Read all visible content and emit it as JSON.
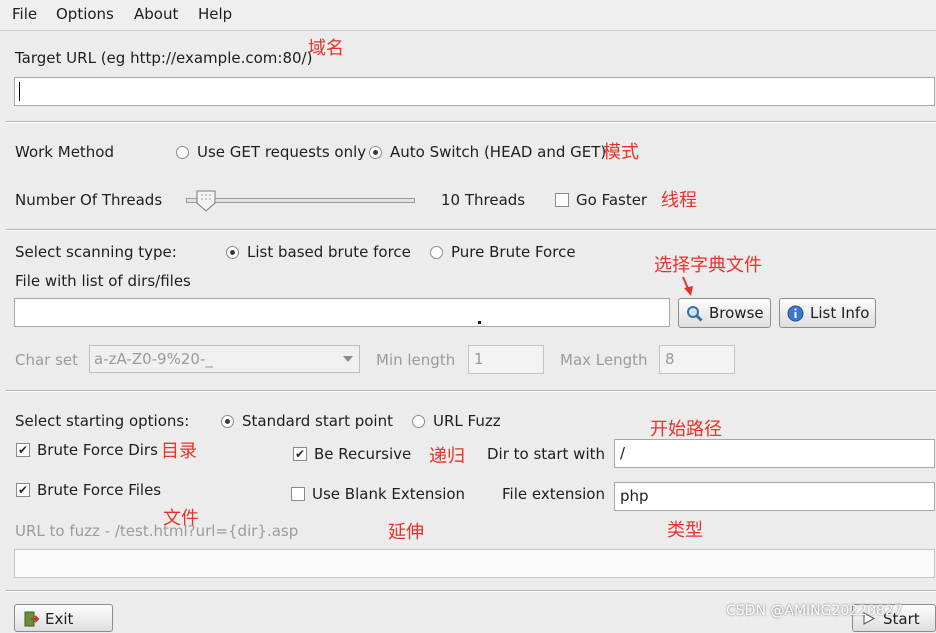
{
  "menu": [
    "File",
    "Options",
    "About",
    "Help"
  ],
  "target": {
    "label": "Target URL (eg http://example.com:80/)",
    "value": ""
  },
  "work_method": {
    "label": "Work Method",
    "options": [
      "Use GET requests only",
      "Auto Switch (HEAD and GET)"
    ],
    "selected": "Auto Switch (HEAD and GET)"
  },
  "threads": {
    "label": "Number Of Threads",
    "value_text": "10 Threads",
    "go_faster": "Go Faster",
    "level_fraction": 0.1
  },
  "scan_type": {
    "label": "Select scanning type:",
    "options": [
      "List based brute force",
      "Pure Brute Force"
    ],
    "selected": "List based brute force"
  },
  "file_list": {
    "label": "File with list of dirs/files",
    "value": "",
    "browse_label": "Browse",
    "list_info_label": "List Info"
  },
  "charset": {
    "label": "Char set",
    "value": "a-zA-Z0-9%20-_",
    "min_label": "Min length",
    "min_value": "1",
    "max_label": "Max Length",
    "max_value": "8"
  },
  "start_options": {
    "label": "Select starting options:",
    "options": [
      "Standard start point",
      "URL Fuzz"
    ],
    "selected": "Standard start point"
  },
  "checks": {
    "brute_dirs": "Brute Force Dirs",
    "brute_files": "Brute Force Files",
    "recursive": "Be Recursive",
    "blank_ext": "Use Blank Extension"
  },
  "dir_start": {
    "label": "Dir to start with",
    "value": "/"
  },
  "file_ext": {
    "label": "File extension",
    "value": "php"
  },
  "url_fuzz": {
    "label": "URL to fuzz - /test.html?url={dir}.asp",
    "value": ""
  },
  "buttons": {
    "exit": "Exit",
    "start": "Start"
  },
  "annotations": {
    "domain": "域名",
    "mode": "模式",
    "threads": "线程",
    "choose_dict": "选择字典文件",
    "start_path": "开始路径",
    "dirs": "目录",
    "recursive": "递归",
    "files": "文件",
    "extension": "延伸",
    "type": "类型"
  },
  "watermark": "CSDN @AMING20220827",
  "colors": {
    "annotation": "#e8312a",
    "background": "#ececec"
  }
}
